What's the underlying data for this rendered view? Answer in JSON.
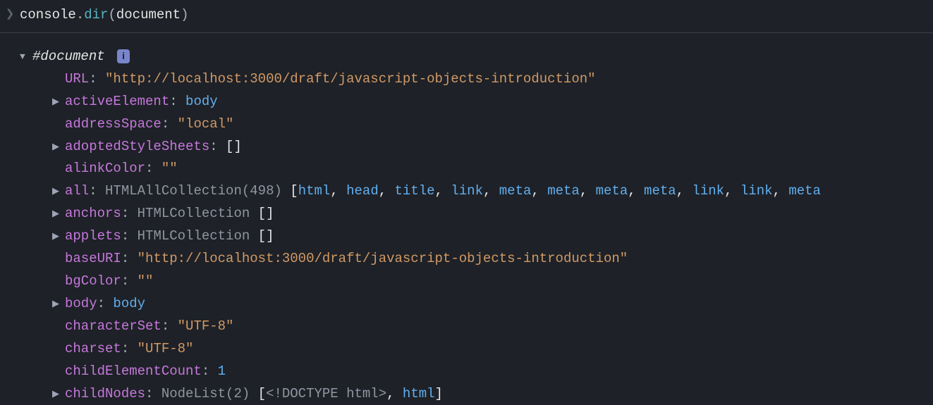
{
  "input": {
    "object": "console",
    "dot": ".",
    "fn": "dir",
    "open": "(",
    "arg": "document",
    "close": ")"
  },
  "root": {
    "name": "#document",
    "info": "i"
  },
  "props": {
    "URL": {
      "k": "URL",
      "colon": ": ",
      "v": "\"http://localhost:3000/draft/javascript-objects-introduction\""
    },
    "activeElement": {
      "k": "activeElement",
      "colon": ": ",
      "v": "body"
    },
    "addressSpace": {
      "k": "addressSpace",
      "colon": ": ",
      "v": "\"local\""
    },
    "adoptedStyleSheets": {
      "k": "adoptedStyleSheets",
      "colon": ": ",
      "v": "[]"
    },
    "alinkColor": {
      "k": "alinkColor",
      "colon": ": ",
      "v": "\"\""
    },
    "all": {
      "k": "all",
      "colon": ": ",
      "type": "HTMLAllCollection(498) ",
      "lb": "[",
      "items": [
        "html",
        "head",
        "title",
        "link",
        "meta",
        "meta",
        "meta",
        "meta",
        "link",
        "link",
        "meta"
      ],
      "sep": ", "
    },
    "anchors": {
      "k": "anchors",
      "colon": ": ",
      "type": "HTMLCollection ",
      "v": "[]"
    },
    "applets": {
      "k": "applets",
      "colon": ": ",
      "type": "HTMLCollection ",
      "v": "[]"
    },
    "baseURI": {
      "k": "baseURI",
      "colon": ": ",
      "v": "\"http://localhost:3000/draft/javascript-objects-introduction\""
    },
    "bgColor": {
      "k": "bgColor",
      "colon": ": ",
      "v": "\"\""
    },
    "body": {
      "k": "body",
      "colon": ": ",
      "v": "body"
    },
    "characterSet": {
      "k": "characterSet",
      "colon": ": ",
      "v": "\"UTF-8\""
    },
    "charset": {
      "k": "charset",
      "colon": ": ",
      "v": "\"UTF-8\""
    },
    "childElementCount": {
      "k": "childElementCount",
      "colon": ": ",
      "v": "1"
    },
    "childNodes": {
      "k": "childNodes",
      "colon": ": ",
      "type": "NodeList(2) ",
      "lb": "[",
      "doctype": "<!DOCTYPE html>",
      "sep": ", ",
      "item2": "html",
      "rb": "]"
    }
  }
}
